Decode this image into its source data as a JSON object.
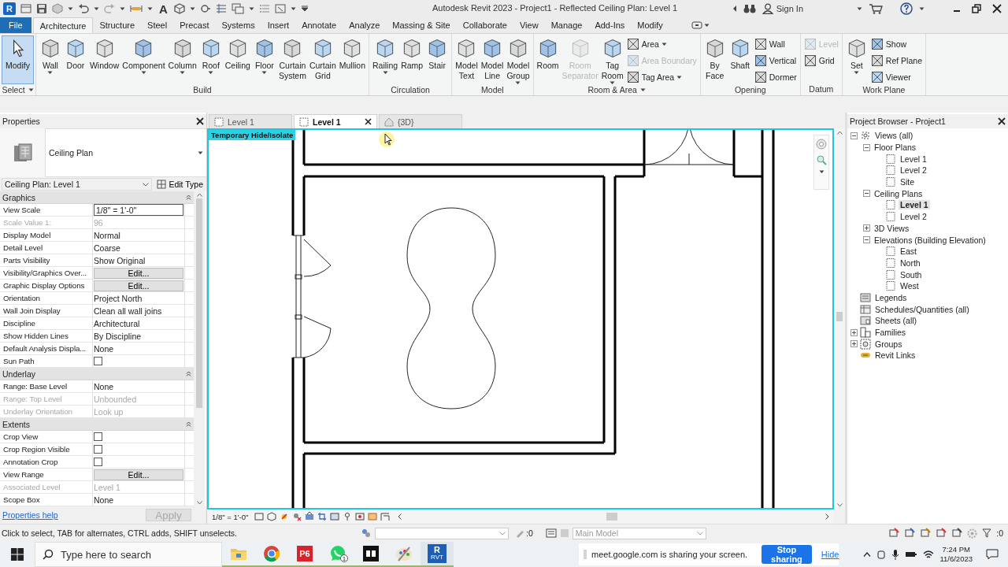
{
  "title_bar": {
    "logo": "R",
    "text_tool": "A",
    "title": "Autodesk Revit 2023 - Project1 - Reflected Ceiling Plan: Level 1",
    "sign_in": "Sign In"
  },
  "menu_tabs": [
    {
      "label": "File",
      "kind": "file",
      "selected": false
    },
    {
      "label": "Architecture",
      "kind": "tab",
      "selected": true
    },
    {
      "label": "Structure",
      "kind": "tab",
      "selected": false
    },
    {
      "label": "Steel",
      "kind": "tab",
      "selected": false
    },
    {
      "label": "Precast",
      "kind": "tab",
      "selected": false
    },
    {
      "label": "Systems",
      "kind": "tab",
      "selected": false
    },
    {
      "label": "Insert",
      "kind": "tab",
      "selected": false
    },
    {
      "label": "Annotate",
      "kind": "tab",
      "selected": false
    },
    {
      "label": "Analyze",
      "kind": "tab",
      "selected": false
    },
    {
      "label": "Massing & Site",
      "kind": "tab",
      "selected": false
    },
    {
      "label": "Collaborate",
      "kind": "tab",
      "selected": false
    },
    {
      "label": "View",
      "kind": "tab",
      "selected": false
    },
    {
      "label": "Manage",
      "kind": "tab",
      "selected": false
    },
    {
      "label": "Add-Ins",
      "kind": "tab",
      "selected": false
    },
    {
      "label": "Modify",
      "kind": "tab",
      "selected": false
    }
  ],
  "ribbon": {
    "panels": [
      {
        "label": "Select",
        "dropdown": true,
        "tools": [
          {
            "label": "Modify",
            "kind": "large",
            "selected": true,
            "disabled": false,
            "dropdown": false
          }
        ]
      },
      {
        "label": "Build",
        "dropdown": false,
        "tools": [
          {
            "label": "Wall",
            "kind": "large",
            "selected": false,
            "disabled": false,
            "dropdown": true
          },
          {
            "label": "Door",
            "kind": "large",
            "selected": false,
            "disabled": false,
            "dropdown": false
          },
          {
            "label": "Window",
            "kind": "large",
            "selected": false,
            "disabled": false,
            "dropdown": false
          },
          {
            "label": "Component",
            "kind": "large",
            "selected": false,
            "disabled": false,
            "dropdown": true
          },
          {
            "label": "Column",
            "kind": "large",
            "selected": false,
            "disabled": false,
            "dropdown": true
          },
          {
            "label": "Roof",
            "kind": "large",
            "selected": false,
            "disabled": false,
            "dropdown": true
          },
          {
            "label": "Ceiling",
            "kind": "large",
            "selected": false,
            "disabled": false,
            "dropdown": false
          },
          {
            "label": "Floor",
            "kind": "large",
            "selected": false,
            "disabled": false,
            "dropdown": true
          },
          {
            "label": "Curtain System",
            "kind": "large",
            "selected": false,
            "disabled": false,
            "dropdown": false
          },
          {
            "label": "Curtain Grid",
            "kind": "large",
            "selected": false,
            "disabled": false,
            "dropdown": false
          },
          {
            "label": "Mullion",
            "kind": "large",
            "selected": false,
            "disabled": false,
            "dropdown": false
          }
        ]
      },
      {
        "label": "Circulation",
        "dropdown": false,
        "tools": [
          {
            "label": "Railing",
            "kind": "large",
            "selected": false,
            "disabled": false,
            "dropdown": true
          },
          {
            "label": "Ramp",
            "kind": "large",
            "selected": false,
            "disabled": false,
            "dropdown": false
          },
          {
            "label": "Stair",
            "kind": "large",
            "selected": false,
            "disabled": false,
            "dropdown": false
          }
        ]
      },
      {
        "label": "Model",
        "dropdown": false,
        "tools": [
          {
            "label": "Model Text",
            "kind": "large",
            "selected": false,
            "disabled": false,
            "dropdown": false
          },
          {
            "label": "Model Line",
            "kind": "large",
            "selected": false,
            "disabled": false,
            "dropdown": false
          },
          {
            "label": "Model Group",
            "kind": "large",
            "selected": false,
            "disabled": false,
            "dropdown": true
          }
        ]
      },
      {
        "label": "Room & Area",
        "dropdown": true,
        "tools": [
          {
            "label": "Room",
            "kind": "large",
            "selected": false,
            "disabled": false,
            "dropdown": false
          },
          {
            "label": "Room Separator",
            "kind": "large",
            "selected": false,
            "disabled": true,
            "dropdown": false
          },
          {
            "label": "Tag Room",
            "kind": "large",
            "selected": false,
            "disabled": false,
            "dropdown": true
          },
          {
            "label": "Area",
            "kind": "small",
            "selected": false,
            "disabled": false,
            "dropdown": true
          },
          {
            "label": "Area Boundary",
            "kind": "small",
            "selected": false,
            "disabled": true,
            "dropdown": false
          },
          {
            "label": "Tag Area",
            "kind": "small",
            "selected": false,
            "disabled": false,
            "dropdown": true
          }
        ]
      },
      {
        "label": "Opening",
        "dropdown": false,
        "tools": [
          {
            "label": "By Face",
            "kind": "large",
            "selected": false,
            "disabled": false,
            "dropdown": false
          },
          {
            "label": "Shaft",
            "kind": "large",
            "selected": false,
            "disabled": false,
            "dropdown": false
          },
          {
            "label": "Wall",
            "kind": "small",
            "selected": false,
            "disabled": false,
            "dropdown": false
          },
          {
            "label": "Vertical",
            "kind": "small",
            "selected": false,
            "disabled": false,
            "dropdown": false
          },
          {
            "label": "Dormer",
            "kind": "small",
            "selected": false,
            "disabled": false,
            "dropdown": false
          }
        ]
      },
      {
        "label": "Datum",
        "dropdown": false,
        "tools": [
          {
            "label": "Level",
            "kind": "small",
            "selected": false,
            "disabled": true,
            "dropdown": false
          },
          {
            "label": "Grid",
            "kind": "small",
            "selected": false,
            "disabled": false,
            "dropdown": false
          }
        ]
      },
      {
        "label": "Work Plane",
        "dropdown": false,
        "tools": [
          {
            "label": "Set",
            "kind": "large",
            "selected": false,
            "disabled": false,
            "dropdown": true
          },
          {
            "label": "Show",
            "kind": "small",
            "selected": false,
            "disabled": false,
            "dropdown": false
          },
          {
            "label": "Ref Plane",
            "kind": "small",
            "selected": false,
            "disabled": false,
            "dropdown": false
          },
          {
            "label": "Viewer",
            "kind": "small",
            "selected": false,
            "disabled": false,
            "dropdown": false
          }
        ]
      }
    ]
  },
  "properties": {
    "title": "Properties",
    "type_name": "Ceiling Plan",
    "instance": "Ceiling Plan: Level 1",
    "edit_type": "Edit Type",
    "groups": [
      {
        "name": "Graphics",
        "rows": [
          {
            "name": "View Scale",
            "kind": "field",
            "value": "1/8\" = 1'-0\"",
            "disabled": false
          },
          {
            "name": "Scale Value 1:",
            "kind": "text",
            "value": "96",
            "disabled": true
          },
          {
            "name": "Display Model",
            "kind": "text",
            "value": "Normal",
            "disabled": false
          },
          {
            "name": "Detail Level",
            "kind": "text",
            "value": "Coarse",
            "disabled": false
          },
          {
            "name": "Parts Visibility",
            "kind": "text",
            "value": "Show Original",
            "disabled": false
          },
          {
            "name": "Visibility/Graphics Over...",
            "kind": "button",
            "value": "Edit...",
            "disabled": false
          },
          {
            "name": "Graphic Display Options",
            "kind": "button",
            "value": "Edit...",
            "disabled": false
          },
          {
            "name": "Orientation",
            "kind": "text",
            "value": "Project North",
            "disabled": false
          },
          {
            "name": "Wall Join Display",
            "kind": "text",
            "value": "Clean all wall joins",
            "disabled": false
          },
          {
            "name": "Discipline",
            "kind": "text",
            "value": "Architectural",
            "disabled": false
          },
          {
            "name": "Show Hidden Lines",
            "kind": "text",
            "value": "By Discipline",
            "disabled": false
          },
          {
            "name": "Default Analysis Displa...",
            "kind": "text",
            "value": "None",
            "disabled": false
          },
          {
            "name": "Sun Path",
            "kind": "checkbox",
            "checked": false,
            "disabled": false
          }
        ]
      },
      {
        "name": "Underlay",
        "rows": [
          {
            "name": "Range: Base Level",
            "kind": "text",
            "value": "None",
            "disabled": false
          },
          {
            "name": "Range: Top Level",
            "kind": "text",
            "value": "Unbounded",
            "disabled": true
          },
          {
            "name": "Underlay Orientation",
            "kind": "text",
            "value": "Look up",
            "disabled": true
          }
        ]
      },
      {
        "name": "Extents",
        "rows": [
          {
            "name": "Crop View",
            "kind": "checkbox",
            "checked": false,
            "disabled": false
          },
          {
            "name": "Crop Region Visible",
            "kind": "checkbox",
            "checked": false,
            "disabled": false
          },
          {
            "name": "Annotation Crop",
            "kind": "checkbox",
            "checked": false,
            "disabled": false
          },
          {
            "name": "View Range",
            "kind": "button",
            "value": "Edit...",
            "disabled": false
          },
          {
            "name": "Associated Level",
            "kind": "text",
            "value": "Level 1",
            "disabled": true
          },
          {
            "name": "Scope Box",
            "kind": "text",
            "value": "None",
            "disabled": false
          }
        ]
      }
    ],
    "help": "Properties help",
    "apply": {
      "label": "Apply",
      "disabled": true
    }
  },
  "doc_tabs": [
    {
      "label": "Level 1",
      "kind": "plan",
      "selected": false
    },
    {
      "label": "Level 1",
      "kind": "plan",
      "selected": true
    },
    {
      "label": "{3D}",
      "kind": "model",
      "selected": false
    }
  ],
  "canvas": {
    "label": "Temporary Hide/Isolate"
  },
  "view_bar": {
    "scale": "1/8\" = 1'-0\""
  },
  "project_browser": {
    "title": "Project Browser - Project1",
    "tree": [
      {
        "label": "Views (all)",
        "kind": "views",
        "expanded": true,
        "selected": false,
        "children": [
          {
            "label": "Floor Plans",
            "expanded": true,
            "selected": false,
            "children": [
              {
                "label": "Level 1",
                "kind": "view",
                "selected": false
              },
              {
                "label": "Level 2",
                "kind": "view",
                "selected": false
              },
              {
                "label": "Site",
                "kind": "view",
                "selected": false
              }
            ]
          },
          {
            "label": "Ceiling Plans",
            "expanded": true,
            "selected": false,
            "children": [
              {
                "label": "Level 1",
                "kind": "view",
                "selected": true
              },
              {
                "label": "Level 2",
                "kind": "view",
                "selected": false
              }
            ]
          },
          {
            "label": "3D Views",
            "expanded": false,
            "selected": false
          },
          {
            "label": "Elevations (Building Elevation)",
            "expanded": true,
            "selected": false,
            "children": [
              {
                "label": "East",
                "kind": "view",
                "selected": false
              },
              {
                "label": "North",
                "kind": "view",
                "selected": false
              },
              {
                "label": "South",
                "kind": "view",
                "selected": false
              },
              {
                "label": "West",
                "kind": "view",
                "selected": false
              }
            ]
          }
        ]
      },
      {
        "label": "Legends",
        "kind": "legends",
        "selected": false
      },
      {
        "label": "Schedules/Quantities (all)",
        "kind": "schedules",
        "selected": false
      },
      {
        "label": "Sheets (all)",
        "kind": "sheets",
        "selected": false
      },
      {
        "label": "Families",
        "kind": "families",
        "expanded": false,
        "selected": false
      },
      {
        "label": "Groups",
        "kind": "groups",
        "expanded": false,
        "selected": false
      },
      {
        "label": "Revit Links",
        "kind": "links",
        "selected": false
      }
    ]
  },
  "status_bar": {
    "hint": "Click to select, TAB for alternates, CTRL adds, SHIFT unselects.",
    "selection_count": ":0",
    "workset": "Main Model",
    "filter_count": ":0"
  },
  "taskbar": {
    "search_placeholder": "Type here to search",
    "apps": [
      {
        "kind": "folder",
        "active": false
      },
      {
        "kind": "chrome",
        "active": false
      },
      {
        "kind": "p6",
        "label": "P6",
        "active": false
      },
      {
        "kind": "whatsapp",
        "badge": "1",
        "active": false
      },
      {
        "kind": "dark",
        "active": false
      },
      {
        "kind": "paint",
        "active": false
      },
      {
        "kind": "revit",
        "label": "R",
        "sublabel": "RVT",
        "active": true
      }
    ],
    "sharing": {
      "text": "meet.google.com is sharing your screen.",
      "stop": "Stop sharing",
      "hide": "Hide"
    },
    "time": "7:24 PM",
    "date": "11/6/2023"
  }
}
